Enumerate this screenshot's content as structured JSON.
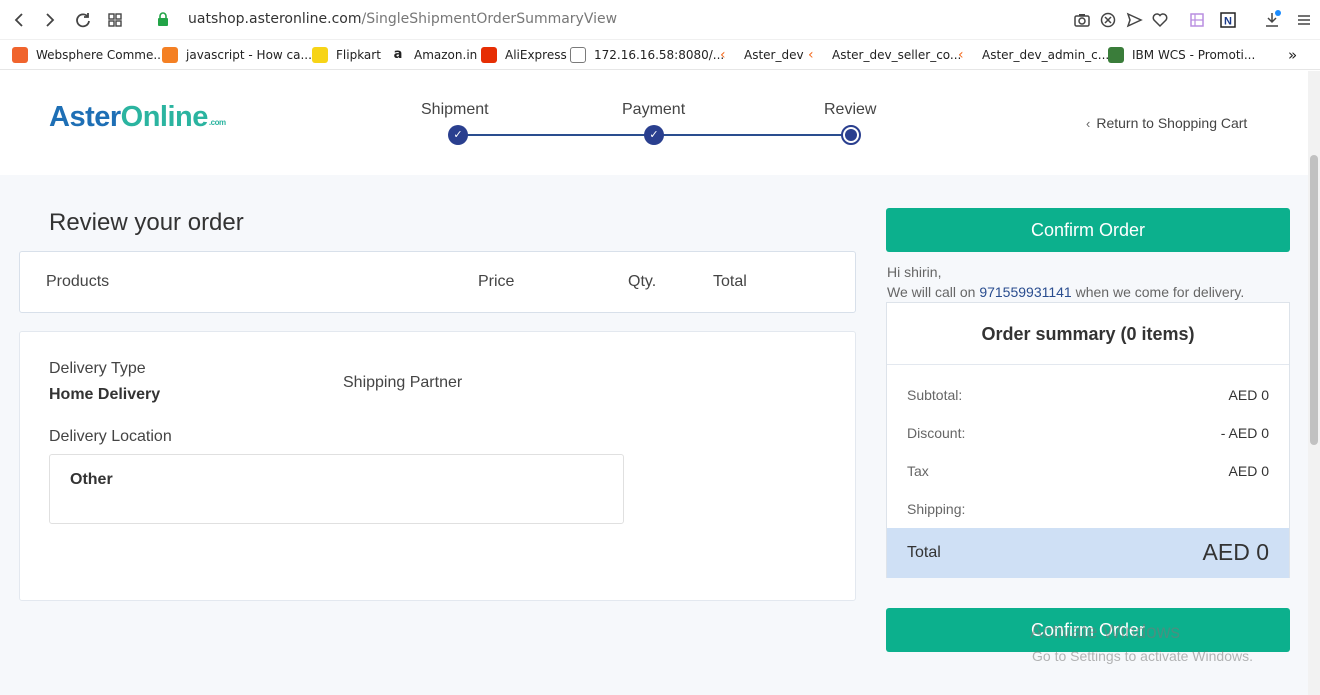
{
  "browser": {
    "url_host": "uatshop.asteronline.com",
    "url_path": "/SingleShipmentOrderSummaryView",
    "bookmarks": [
      {
        "label": "Websphere Comme...",
        "color": "#f0642d"
      },
      {
        "label": "javascript - How ca...",
        "color": "#f48024"
      },
      {
        "label": "Flipkart",
        "color": "#f7d417"
      },
      {
        "label": "Amazon.in",
        "color": "#222222"
      },
      {
        "label": "AliExpress",
        "color": "#e62e04"
      },
      {
        "label": "172.16.16.58:8080/...",
        "color": "#7a7a7a"
      },
      {
        "label": "Aster_dev",
        "color": "#f36c21"
      },
      {
        "label": "Aster_dev_seller_co...",
        "color": "#f36c21"
      },
      {
        "label": "Aster_dev_admin_c...",
        "color": "#f36c21"
      },
      {
        "label": "IBM WCS - Promoti...",
        "color": "#3a7d3a"
      }
    ],
    "more_bookmarks": "»"
  },
  "header": {
    "logo_part1": "Aster",
    "logo_part2": "Online",
    "logo_suffix": ".com",
    "steps": [
      {
        "label": "Shipment",
        "state": "done"
      },
      {
        "label": "Payment",
        "state": "done"
      },
      {
        "label": "Review",
        "state": "current"
      }
    ],
    "return_link": "Return to Shopping Cart"
  },
  "review": {
    "title": "Review your order",
    "columns": {
      "products": "Products",
      "price": "Price",
      "qty": "Qty.",
      "total": "Total"
    },
    "delivery_type_label": "Delivery Type",
    "delivery_type_value": "Home Delivery",
    "shipping_partner_label": "Shipping Partner",
    "delivery_location_label": "Delivery Location",
    "delivery_location_value": "Other"
  },
  "sidebar": {
    "confirm_label": "Confirm Order",
    "greeting": "Hi shirin,",
    "call_prefix": "We will call on",
    "phone": "971559931141",
    "call_suffix": "when we come for delivery.",
    "summary_title": "Order summary (0 items)",
    "rows": [
      {
        "label": "Subtotal:",
        "value": "AED 0"
      },
      {
        "label": "Discount:",
        "value": "- AED 0"
      },
      {
        "label": "Tax",
        "value": "AED 0"
      },
      {
        "label": "Shipping:",
        "value": ""
      }
    ],
    "total_label": "Total",
    "total_value": "AED 0"
  },
  "watermark": {
    "line1": "Activate Windows",
    "line2": "Go to Settings to activate Windows."
  },
  "colors": {
    "accent_green": "#0cb08d",
    "step_blue": "#2a3f8f",
    "total_bg": "#cfe0f5"
  }
}
